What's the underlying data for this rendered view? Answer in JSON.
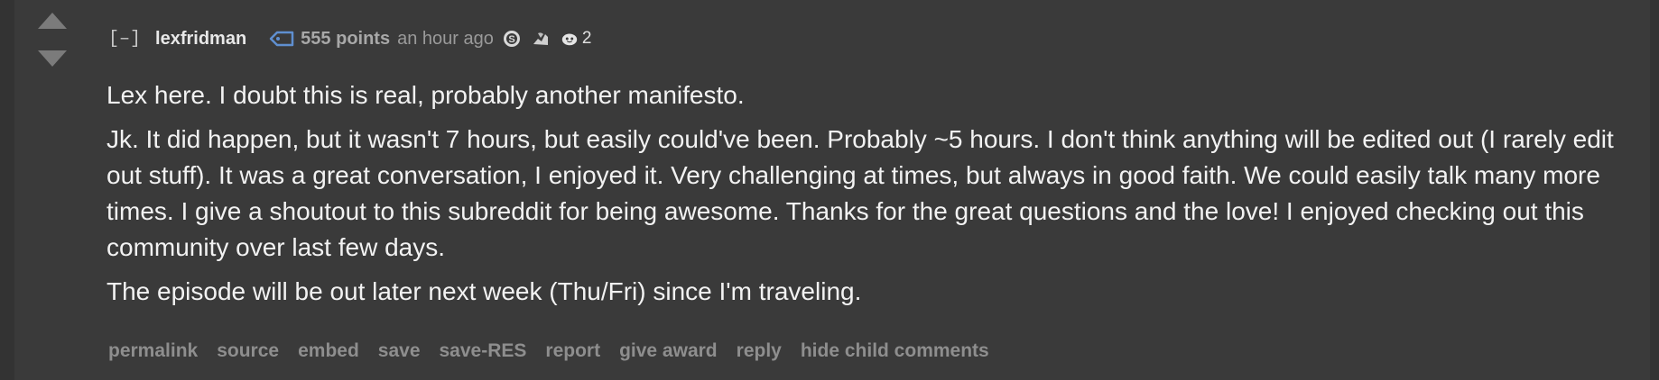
{
  "comment": {
    "expand_label": "[–]",
    "author": "lexfridman",
    "score": "555 points",
    "time": "an hour ago",
    "award_icons": [
      "silver-award-icon",
      "helpful-award-icon",
      "wholesome-award-icon"
    ],
    "award_count": "2",
    "colors": {
      "background": "#3a3a3a",
      "text": "#f2f2f2",
      "muted": "#8e8e8e",
      "tag_icon": "#5f8fd0"
    },
    "paragraphs": [
      "Lex here. I doubt this is real, probably another manifesto.",
      "Jk. It did happen, but it wasn't 7 hours, but easily could've been. Probably ~5 hours. I don't think anything will be edited out (I rarely edit out stuff). It was a great conversation, I enjoyed it. Very challenging at times, but always in good faith. We could easily talk many more times. I give a shoutout to this subreddit for being awesome. Thanks for the great questions and the love! I enjoyed checking out this community over last few days.",
      "The episode will be out later next week (Thu/Fri) since I'm traveling."
    ],
    "buttons": [
      "permalink",
      "source",
      "embed",
      "save",
      "save-RES",
      "report",
      "give award",
      "reply",
      "hide child comments"
    ]
  }
}
